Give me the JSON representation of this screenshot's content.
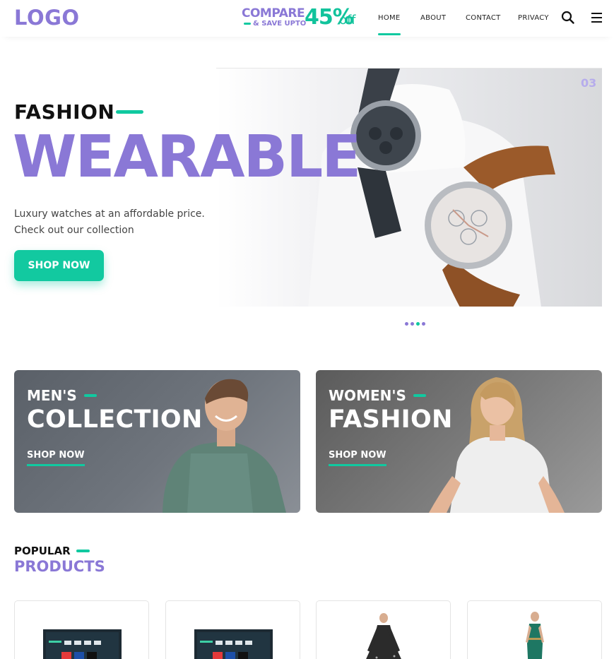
{
  "header": {
    "logo": "LOGO",
    "promo": {
      "compare": "COMPARE",
      "save": "& SAVE UPTO",
      "percent": "45%",
      "off": "off"
    },
    "nav": [
      "HOME",
      "ABOUT",
      "CONTACT",
      "PRIVACY"
    ],
    "active_nav": "HOME",
    "icons": [
      "search-icon",
      "menu-icon"
    ]
  },
  "hero": {
    "slide_number": "03",
    "kicker": "FASHION",
    "headline": "WEARABLE",
    "description_line1": "Luxury watches at an affordable price.",
    "description_line2": "Check out our collection",
    "cta": "SHOP NOW",
    "slide_count": 4,
    "active_slide": 3
  },
  "collections": [
    {
      "kicker": "MEN'S",
      "title": "COLLECTION",
      "cta": "SHOP NOW"
    },
    {
      "kicker": "WOMEN'S",
      "title": "FASHION",
      "cta": "SHOP NOW"
    }
  ],
  "popular": {
    "kicker": "POPULAR",
    "title": "PRODUCTS"
  },
  "colors": {
    "brand_purple": "#8a78d6",
    "accent_green": "#10c9a0"
  }
}
